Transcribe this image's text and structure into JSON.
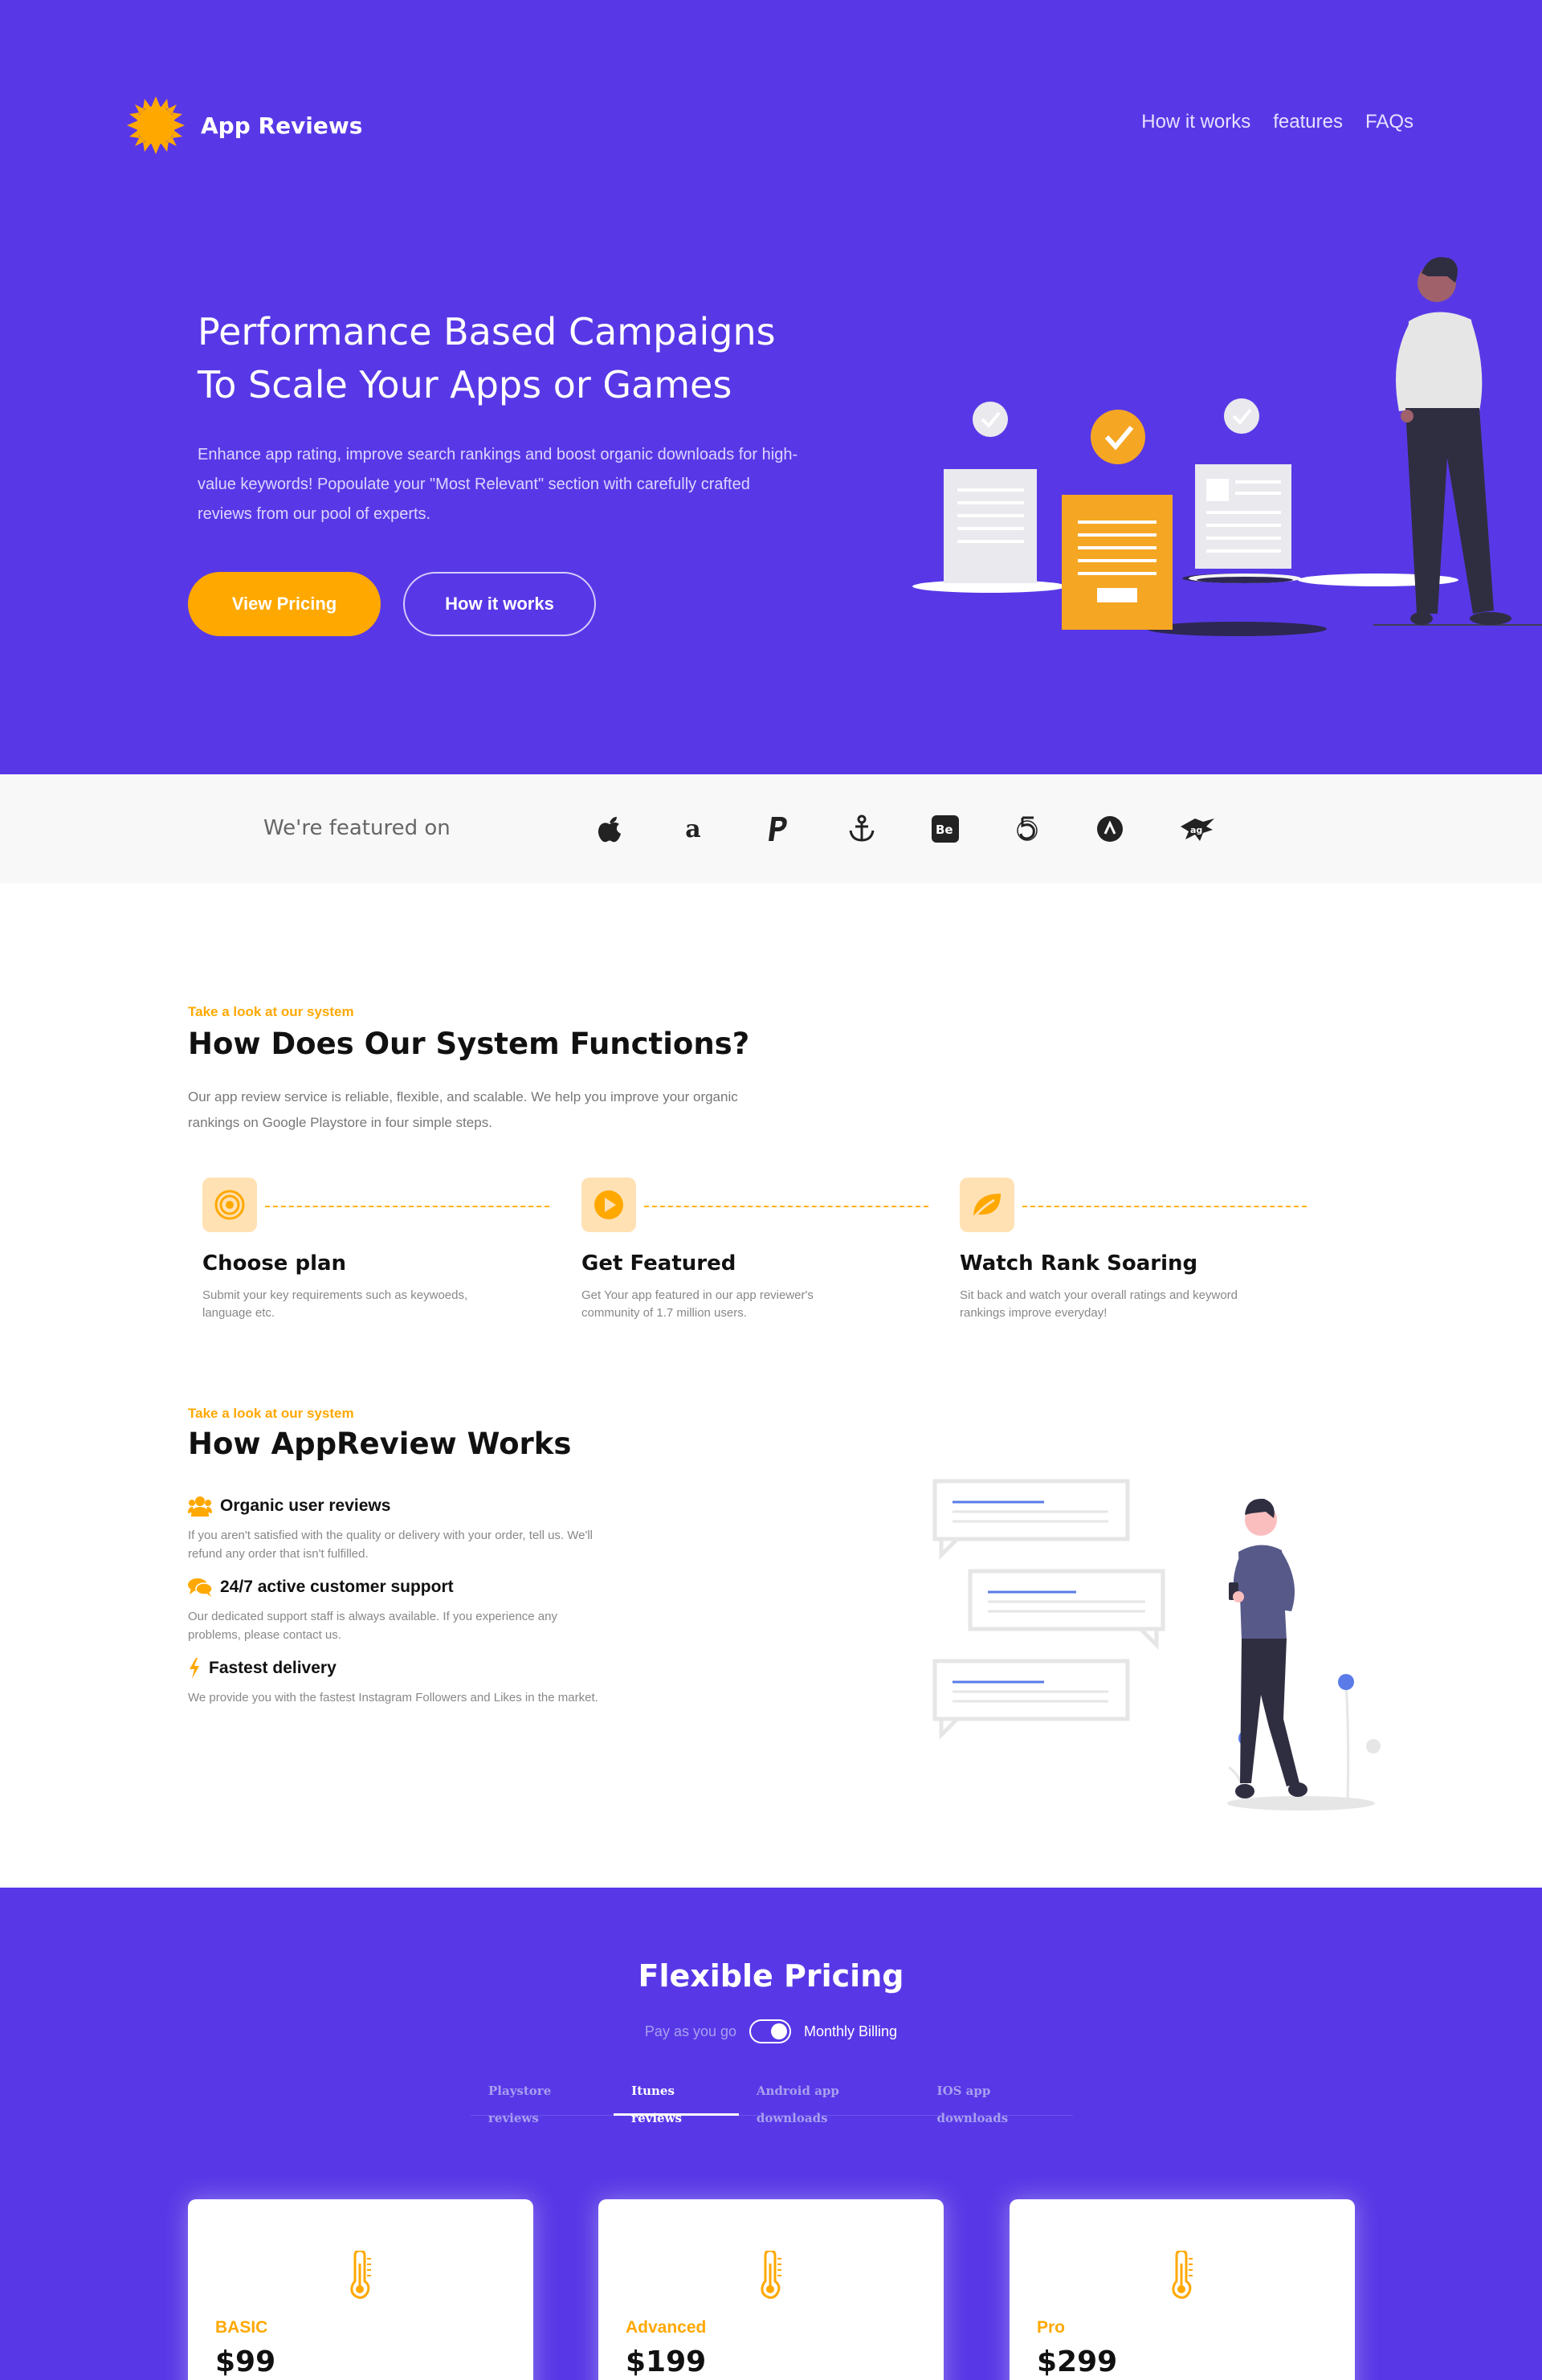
{
  "brand": {
    "name": "App Reviews",
    "logo_icon": "sun-badge-icon",
    "accent": "#ffa800",
    "primary": "#5838e6"
  },
  "nav": {
    "items": [
      "How it works",
      "features",
      "FAQs"
    ]
  },
  "hero": {
    "title": "Performance Based Campaigns To Scale Your Apps or Games",
    "text": "Enhance app rating, improve search rankings and boost organic downloads for high-value keywords! Popoulate your \"Most Relevant\" section with carefully crafted reviews from our pool of experts.",
    "primary_button": "View Pricing",
    "secondary_button": "How it works"
  },
  "featured": {
    "label": "We're featured on",
    "brands": [
      "apple-icon",
      "amazon-icon",
      "paypal-icon",
      "anchor-icon",
      "behance-icon",
      "500px-icon",
      "angellist-icon",
      "aviato-icon"
    ]
  },
  "system": {
    "kicker": "Take a look at our system",
    "title": "How Does Our System Functions?",
    "description": "Our app review service is reliable, flexible, and scalable. We help you improve your organic rankings on Google Playstore in four simple steps.",
    "steps": [
      {
        "title": "Choose plan",
        "desc": "Submit your key requirements such as keywoeds, language etc.",
        "icon": "target-icon"
      },
      {
        "title": "Get Featured",
        "desc": "Get Your app featured in our app reviewer's community of 1.7 million users.",
        "icon": "play-icon"
      },
      {
        "title": "Watch Rank Soaring",
        "desc": "Sit back and watch your overall ratings and keyword rankings improve everyday!",
        "icon": "leaf-icon"
      }
    ]
  },
  "works": {
    "kicker": "Take a look at our system",
    "title": "How AppReview Works",
    "items": [
      {
        "title": "Organic user reviews",
        "desc": "If you aren't satisfied with the quality or delivery with your order, tell us. We'll refund any order that isn't fulfilled.",
        "icon": "users-icon"
      },
      {
        "title": "24/7 active customer support",
        "desc": "Our dedicated support staff is always available. If you experience any problems, please contact us.",
        "icon": "chat-icon"
      },
      {
        "title": "Fastest delivery",
        "desc": "We provide you with the fastest Instagram Followers and Likes in the market.",
        "icon": "bolt-icon"
      }
    ]
  },
  "pricing": {
    "title": "Flexible Pricing",
    "billing_off": "Pay as you go",
    "billing_on": "Monthly Billing",
    "tabs": [
      "Playstore reviews",
      "Itunes reviews",
      "Android app downloads",
      "IOS app downloads"
    ],
    "active_tab": "Itunes reviews",
    "plans": [
      {
        "name": "BASIC",
        "price": "$99"
      },
      {
        "name": "Advanced",
        "price": "$199"
      },
      {
        "name": "Pro",
        "price": "$299"
      }
    ]
  }
}
